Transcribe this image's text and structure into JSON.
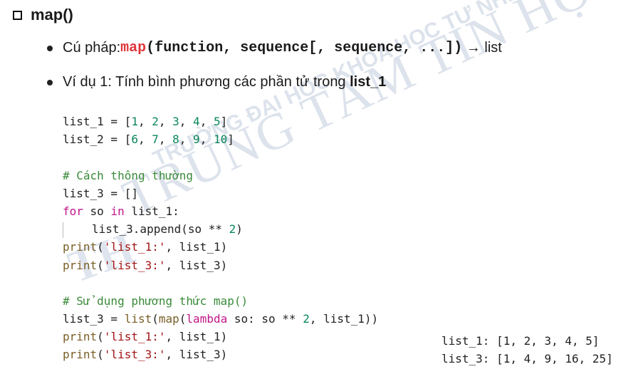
{
  "watermark": {
    "line1": "TRUNG TÂM TIN HỌC",
    "line2": "TRƯỜNG ĐẠI HỌC KHOA HỌC TỰ NHIÊN",
    "logo": "TH"
  },
  "title": "map()",
  "syntax": {
    "label": "Cú pháp: ",
    "func": "map",
    "args": "(function, sequence[, sequence, ...])",
    "arrow": " → list"
  },
  "example": {
    "label": "Ví dụ 1: Tính bình phương các phần tử trong ",
    "target": "list_1"
  },
  "code": {
    "l1a": "list_1 = [",
    "l1n": [
      "1",
      "2",
      "3",
      "4",
      "5"
    ],
    "l2a": "list_2 = [",
    "l2n": [
      "6",
      "7",
      "8",
      "9",
      "10"
    ],
    "c1": "# Cách thông thường",
    "l4": "list_3 = []",
    "for_kw": "for",
    "for_var": " so ",
    "in_kw": "in",
    "for_rest": " list_1:",
    "append": "list_3.append(so ** ",
    "append_n": "2",
    "append_end": ")",
    "p1_fn": "print",
    "p1_s": "'list_1:'",
    "p1_r": ", list_1)",
    "p2_fn": "print",
    "p2_s": "'list_3:'",
    "p2_r": ", list_3)",
    "c2": "# Sử dụng phương thức map()",
    "m_a": "list_3 = ",
    "m_list": "list",
    "m_b": "(",
    "m_map": "map",
    "m_c": "(",
    "m_lambda": "lambda",
    "m_d": " so: so ** ",
    "m_n": "2",
    "m_e": ", list_1))",
    "p3_fn": "print",
    "p3_s": "'list_1:'",
    "p3_r": ", list_1)",
    "p4_fn": "print",
    "p4_s": "'list_3:'",
    "p4_r": ", list_3)"
  },
  "output": {
    "line1": "list_1: [1, 2, 3, 4, 5]",
    "line2": "list_3: [1, 4, 9, 16, 25]"
  }
}
